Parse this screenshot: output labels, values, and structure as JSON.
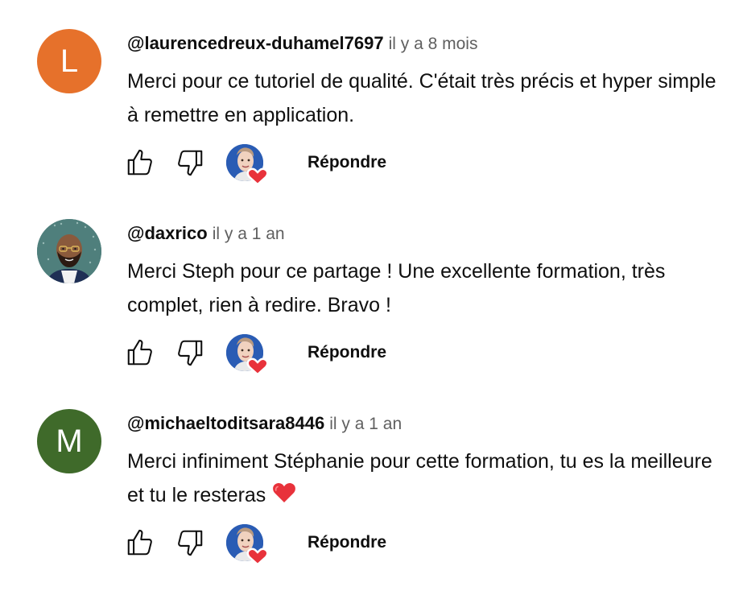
{
  "comments": [
    {
      "avatar_type": "letter",
      "avatar_letter": "L",
      "avatar_color": "#e6712b",
      "author": "@laurencedreux-duhamel7697",
      "time": "il y a 8 mois",
      "text": "Merci pour ce tutoriel de qualité. C'était très précis et hyper simple à remettre en application.",
      "trailing_emoji": "",
      "reply_label": "Répondre"
    },
    {
      "avatar_type": "illustration",
      "avatar_letter": "",
      "avatar_color": "#4f7f7c",
      "author": "@daxrico",
      "time": "il y a 1 an",
      "text": "Merci Steph pour ce partage !  Une excellente formation, très complet, rien à redire. Bravo !",
      "trailing_emoji": "",
      "reply_label": "Répondre"
    },
    {
      "avatar_type": "letter",
      "avatar_letter": "M",
      "avatar_color": "#3f6a2a",
      "author": "@michaeltoditsara8446",
      "time": "il y a 1 an",
      "text": "Merci infiniment Stéphanie pour cette formation, tu es la meilleure et tu le resteras",
      "trailing_emoji": "heart",
      "reply_label": "Répondre"
    }
  ],
  "icons": {
    "like": "thumbs-up-icon",
    "dislike": "thumbs-down-icon",
    "creator_heart": "creator-heart-icon"
  },
  "colors": {
    "text": "#0f0f0f",
    "secondary_text": "#606060",
    "heart_red": "#e8323b",
    "creator_avatar_bg": "#1e4fa3"
  }
}
